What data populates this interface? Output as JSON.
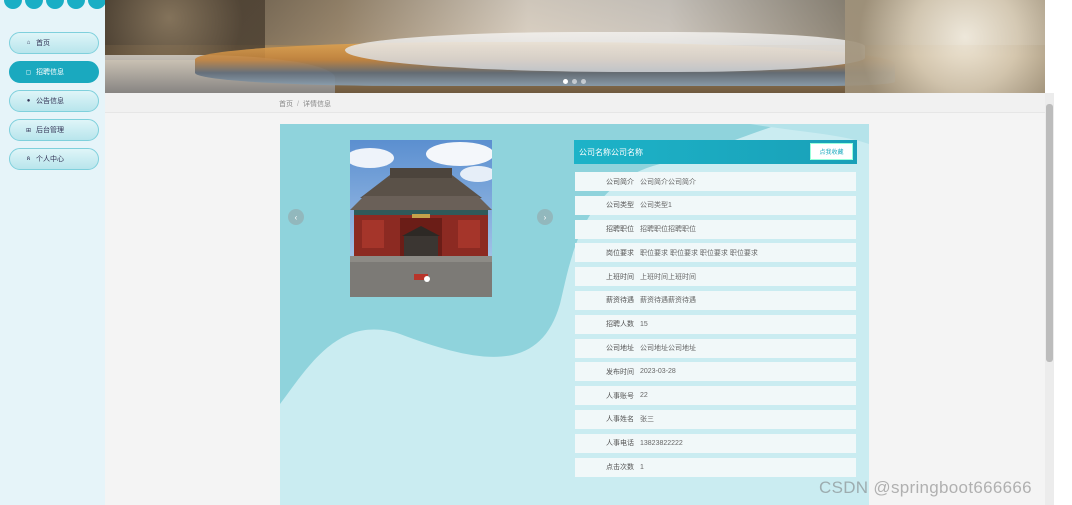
{
  "sidebar": {
    "items": [
      {
        "label": "首页",
        "icon": "home-icon",
        "active": false
      },
      {
        "label": "招聘信息",
        "icon": "briefcase-icon",
        "active": true
      },
      {
        "label": "公告信息",
        "icon": "bell-icon",
        "active": false
      },
      {
        "label": "后台管理",
        "icon": "admin-icon",
        "active": false
      },
      {
        "label": "个人中心",
        "icon": "user-icon",
        "active": false
      }
    ]
  },
  "breadcrumb": {
    "home": "首页",
    "separator": "/",
    "current": "详情信息"
  },
  "detail": {
    "title": "公司名称公司名称",
    "favorite_label": "点我收藏",
    "fields": [
      {
        "label": "公司简介",
        "value": "公司简介公司简介"
      },
      {
        "label": "公司类型",
        "value": "公司类型1"
      },
      {
        "label": "招聘职位",
        "value": "招聘职位招聘职位"
      },
      {
        "label": "岗位要求",
        "value": "职位要求 职位要求 职位要求 职位要求"
      },
      {
        "label": "上班时间",
        "value": "上班时间上班时间"
      },
      {
        "label": "薪资待遇",
        "value": "薪资待遇薪资待遇"
      },
      {
        "label": "招聘人数",
        "value": "15"
      },
      {
        "label": "公司地址",
        "value": "公司地址公司地址"
      },
      {
        "label": "发布时间",
        "value": "2023-03-28"
      },
      {
        "label": "人事账号",
        "value": "22"
      },
      {
        "label": "人事姓名",
        "value": "张三"
      },
      {
        "label": "人事电话",
        "value": "13823822222"
      },
      {
        "label": "点击次数",
        "value": "1"
      }
    ]
  },
  "carousel": {
    "prev_icon": "‹",
    "next_icon": "›"
  },
  "watermark": "CSDN @springboot666666",
  "colors": {
    "accent": "#1aa9bf",
    "card_bg": "#caecf1",
    "wave": "#8fd3dc"
  }
}
